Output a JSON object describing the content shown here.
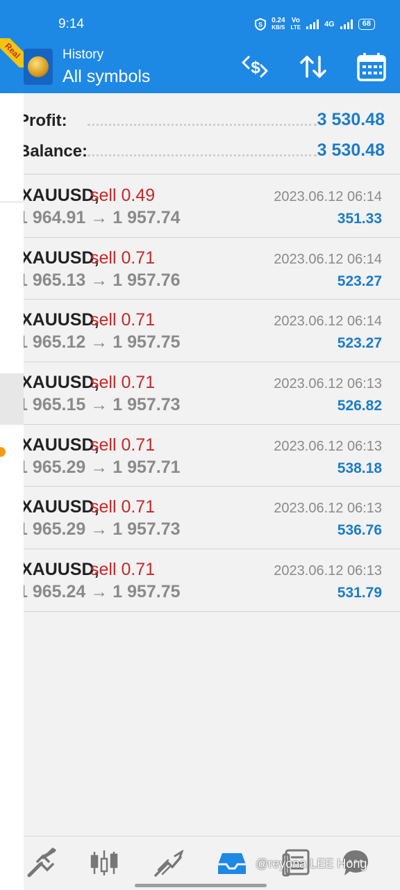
{
  "status_bar": {
    "time": "9:14",
    "net_speed_value": "0.24",
    "net_speed_unit": "KB/S",
    "volte_top": "Vo",
    "volte_bottom": "LTE",
    "network": "4G",
    "battery": "68"
  },
  "app_bar": {
    "title": "History",
    "subtitle": "All symbols",
    "account_badge": "Real",
    "icons": [
      "currency-exchange-icon",
      "sort-icon",
      "calendar-icon"
    ]
  },
  "summary": {
    "profit_label": "Profit:",
    "profit_value": "3 530.48",
    "balance_label": "Balance:",
    "balance_value": "3 530.48"
  },
  "deals": [
    {
      "symbol": "XAUUSD,",
      "type": "sell 0.49",
      "open_price": "1 964.91",
      "arrow": "→",
      "close_price": "1 957.74",
      "time": "2023.06.12 06:14",
      "profit": "351.33"
    },
    {
      "symbol": "XAUUSD,",
      "type": "sell 0.71",
      "open_price": "1 965.13",
      "arrow": "→",
      "close_price": "1 957.76",
      "time": "2023.06.12 06:14",
      "profit": "523.27"
    },
    {
      "symbol": "XAUUSD,",
      "type": "sell 0.71",
      "open_price": "1 965.12",
      "arrow": "→",
      "close_price": "1 957.75",
      "time": "2023.06.12 06:14",
      "profit": "523.27"
    },
    {
      "symbol": "XAUUSD,",
      "type": "sell 0.71",
      "open_price": "1 965.15",
      "arrow": "→",
      "close_price": "1 957.73",
      "time": "2023.06.12 06:13",
      "profit": "526.82"
    },
    {
      "symbol": "XAUUSD,",
      "type": "sell 0.71",
      "open_price": "1 965.29",
      "arrow": "→",
      "close_price": "1 957.71",
      "time": "2023.06.12 06:13",
      "profit": "538.18"
    },
    {
      "symbol": "XAUUSD,",
      "type": "sell 0.71",
      "open_price": "1 965.29",
      "arrow": "→",
      "close_price": "1 957.73",
      "time": "2023.06.12 06:13",
      "profit": "536.76"
    },
    {
      "symbol": "XAUUSD,",
      "type": "sell 0.71",
      "open_price": "1 965.24",
      "arrow": "→",
      "close_price": "1 957.75",
      "time": "2023.06.12 06:13",
      "profit": "531.79"
    }
  ],
  "bottom_nav": {
    "items": [
      "quotes-icon",
      "chart-icon",
      "trade-icon",
      "history-icon",
      "news-icon",
      "messages-icon"
    ],
    "active_index": 3
  },
  "watermark": "@reyona LEE Hong",
  "colors": {
    "accent": "#1e88e5",
    "profit": "#1c7cc9",
    "sell": "#c62828",
    "muted": "#8a8a8a",
    "badge": "#f6c40e"
  }
}
